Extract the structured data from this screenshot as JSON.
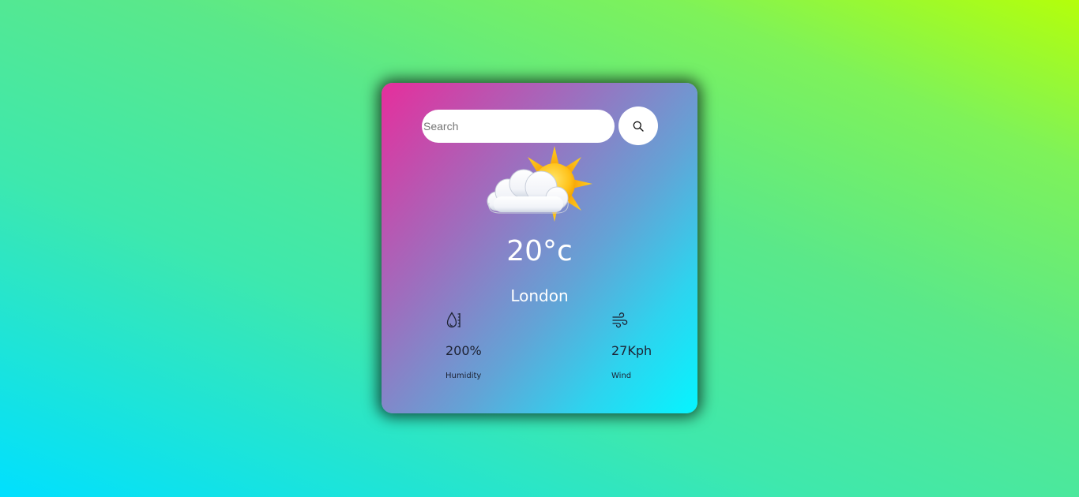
{
  "colors": {
    "background_gradient": [
      "#00e0ff",
      "#b4ff0a"
    ],
    "card_gradient": [
      "#e62e9c",
      "#05f5ff"
    ],
    "text_primary": "#ffffff",
    "text_dark": "#1d2233"
  },
  "search": {
    "placeholder": "Search",
    "value": "",
    "button_icon": "search-icon"
  },
  "weather": {
    "icon": "partly-cloudy-icon",
    "temperature": "20°c",
    "city": "London"
  },
  "stats": {
    "humidity": {
      "icon": "humidity-icon",
      "value": "200%",
      "label": "Humidity"
    },
    "wind": {
      "icon": "wind-icon",
      "value": "27Kph",
      "label": "Wind"
    }
  }
}
